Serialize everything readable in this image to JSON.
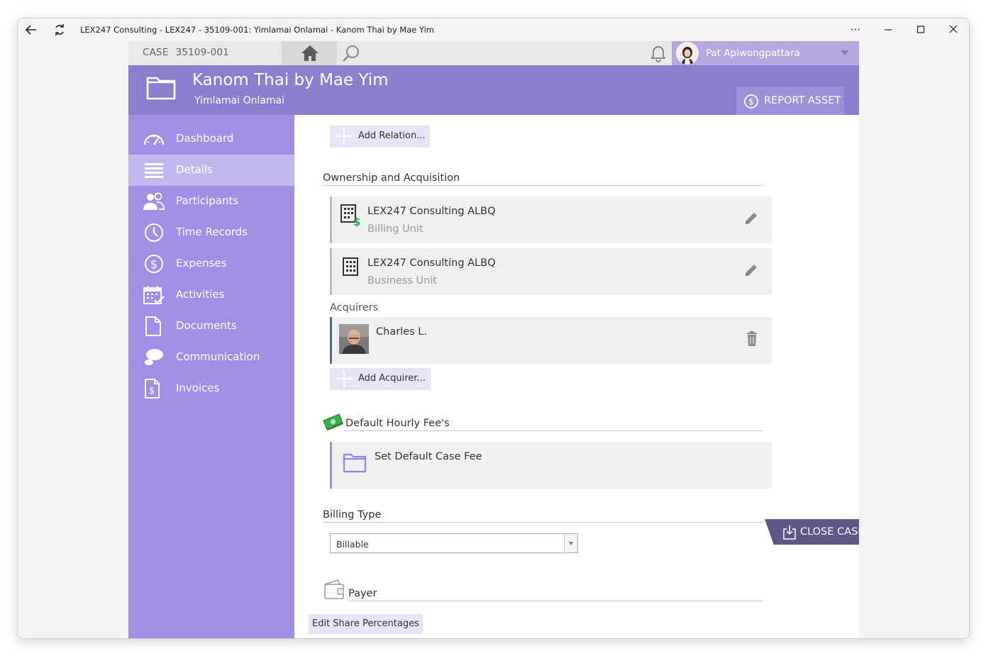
{
  "window": {
    "title": "LEX247 Consulting - LEX247 - 35109-001: Yimlamai Onlamai - Kanom Thai by Mae Yim",
    "more_label": "···"
  },
  "topbar": {
    "case_label": "CASE",
    "case_number": "35109-001",
    "user_name": "Pat Apiwongpattara"
  },
  "header": {
    "title": "Kanom Thai by Mae Yim",
    "subtitle": "Yimlamai Onlamai",
    "report_label": "REPORT ASSET"
  },
  "sidebar": {
    "items": [
      {
        "label": "Dashboard",
        "icon": "gauge-icon"
      },
      {
        "label": "Details",
        "icon": "list-icon",
        "active": true
      },
      {
        "label": "Participants",
        "icon": "people-icon"
      },
      {
        "label": "Time Records",
        "icon": "clock-icon"
      },
      {
        "label": "Expenses",
        "icon": "dollar-circle-icon"
      },
      {
        "label": "Activities",
        "icon": "calendar-check-icon"
      },
      {
        "label": "Documents",
        "icon": "document-icon"
      },
      {
        "label": "Communication",
        "icon": "chat-icon"
      },
      {
        "label": "Invoices",
        "icon": "invoice-icon"
      }
    ]
  },
  "content": {
    "add_relation": "Add Relation...",
    "ownership_title": "Ownership and Acquisition",
    "ownership_cards": [
      {
        "title": "LEX247 Consulting ALBQ",
        "subtitle": "Billing Unit"
      },
      {
        "title": "LEX247 Consulting ALBQ",
        "subtitle": "Business Unit"
      }
    ],
    "acquirers_label": "Acquirers",
    "acquirer": {
      "name": "Charles L."
    },
    "add_acquirer": "Add Acquirer...",
    "fee_title": "Default Hourly Fee's",
    "fee_card": "Set Default Case Fee",
    "billing_title": "Billing Type",
    "billing_value": "Billable",
    "payer_title": "Payer",
    "edit_share": "Edit Share Percentages",
    "close_case": "CLOSE CASE"
  },
  "colors": {
    "header_purple": "#8c7dcf",
    "sidebar_purple": "#a18fe6",
    "active_item": "#c2b7f0",
    "acquirer_accent": "#4d5fc4"
  }
}
